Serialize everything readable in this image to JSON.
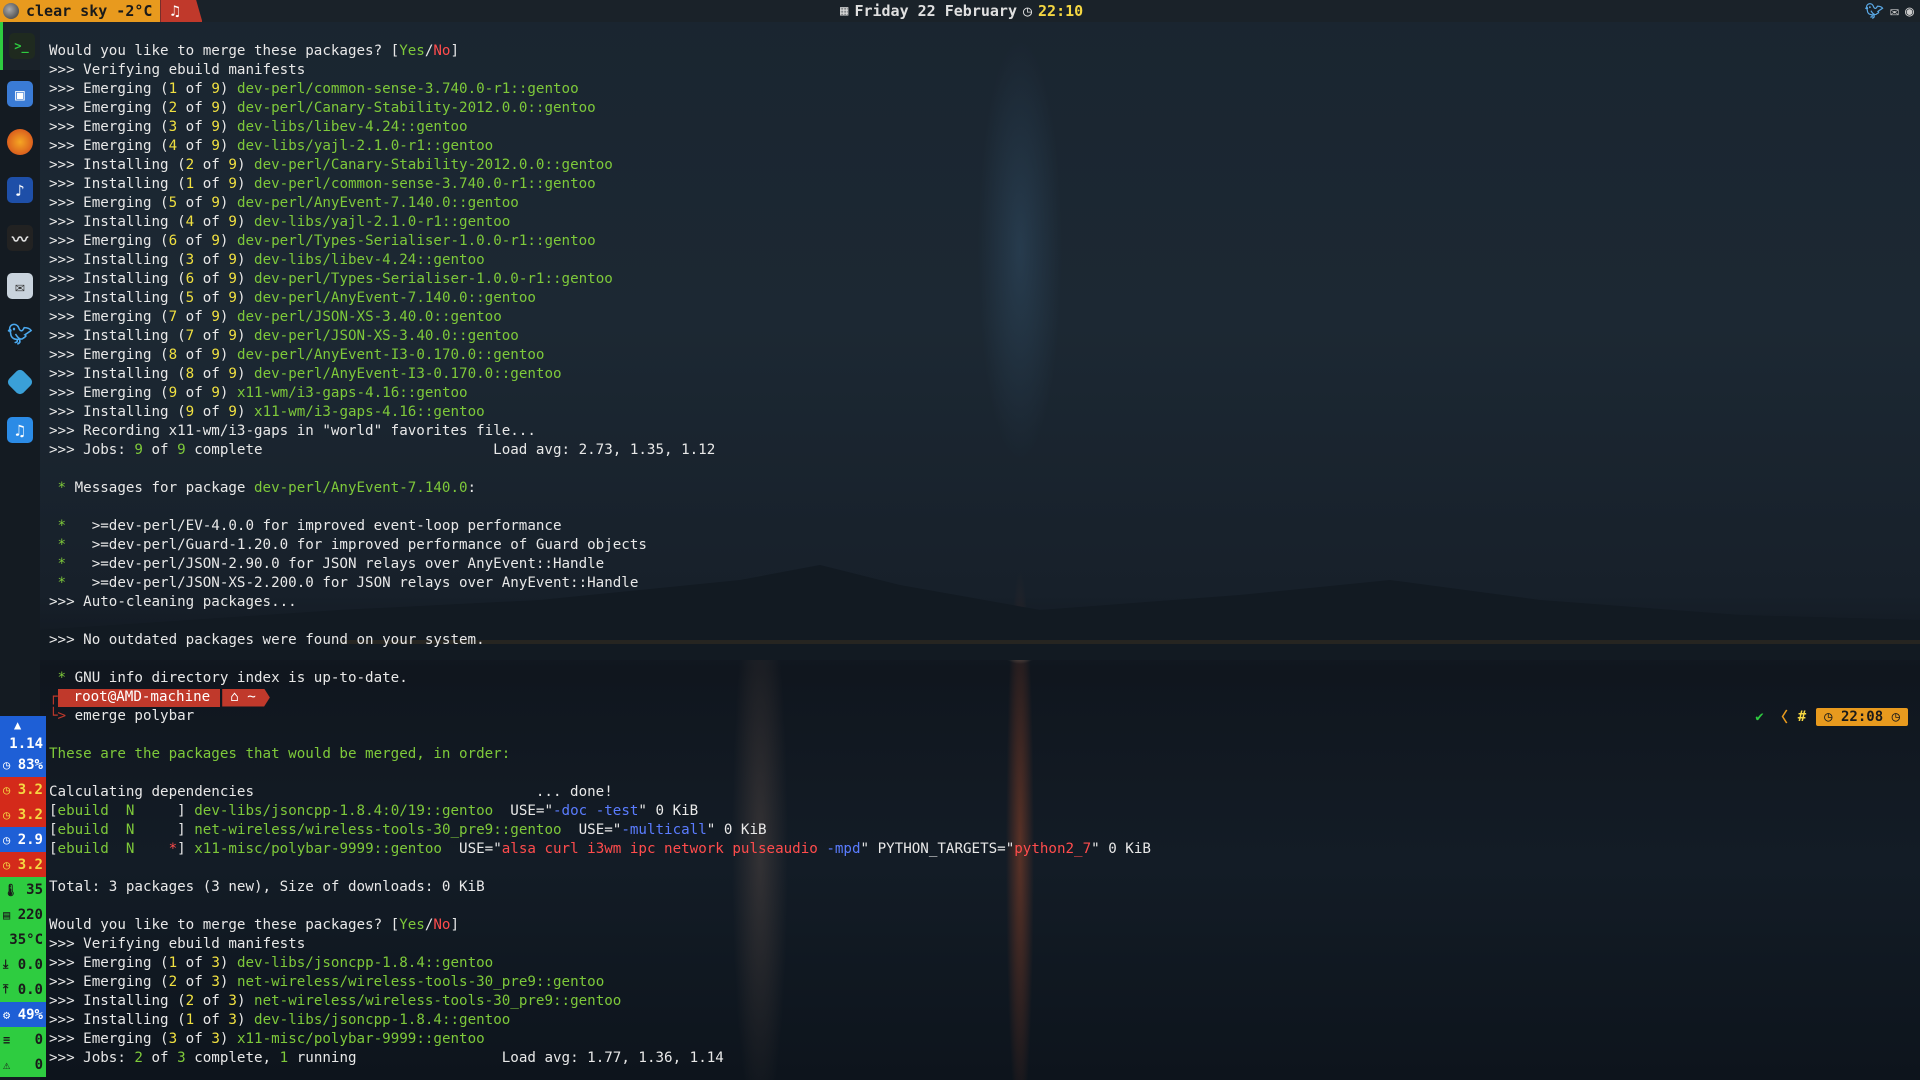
{
  "topbar": {
    "weather": "clear sky -2°C",
    "music_icon": "music-note-icon",
    "date": "Friday 22 February",
    "time": "22:10",
    "tray_icons": [
      "twitter-icon",
      "mail-icon",
      "steam-icon"
    ]
  },
  "dock": {
    "items": [
      "terminal",
      "files",
      "firefox",
      "music-player",
      "mixer",
      "mail",
      "twitter",
      "kodi",
      "itunes"
    ]
  },
  "stats": [
    {
      "icon": "cpu-icon",
      "value": "1.14",
      "bg": "#1e5fd6",
      "fg": "#ffffff"
    },
    {
      "icon": "clock-icon",
      "value": "83%",
      "bg": "#1e5fd6",
      "fg": "#ffffff"
    },
    {
      "icon": "clock-icon",
      "value": "3.2",
      "bg": "#d42a1a",
      "fg": "#f5d742"
    },
    {
      "icon": "clock-icon",
      "value": "3.2",
      "bg": "#d42a1a",
      "fg": "#f5d742"
    },
    {
      "icon": "clock-icon",
      "value": "2.9",
      "bg": "#1e5fd6",
      "fg": "#ffffff"
    },
    {
      "icon": "clock-icon",
      "value": "3.2",
      "bg": "#d42a1a",
      "fg": "#f5d742"
    },
    {
      "icon": "thermometer-icon",
      "value": "35",
      "bg": "#2ecc40",
      "fg": "#1a1a1a"
    },
    {
      "icon": "memory-icon",
      "value": "220",
      "bg": "#2ecc40",
      "fg": "#1a1a1a"
    },
    {
      "icon": "",
      "value": "35°C",
      "bg": "#2ecc40",
      "fg": "#1a1a1a"
    },
    {
      "icon": "download-icon",
      "value": "0.0",
      "bg": "#2ecc40",
      "fg": "#1a1a1a"
    },
    {
      "icon": "upload-icon",
      "value": "0.0",
      "bg": "#2ecc40",
      "fg": "#1a1a1a"
    },
    {
      "icon": "gear-icon",
      "value": "49%",
      "bg": "#1e5fd6",
      "fg": "#ffffff"
    },
    {
      "icon": "list-icon",
      "value": "0",
      "bg": "#2ecc40",
      "fg": "#1a1a1a"
    },
    {
      "icon": "warning-icon",
      "value": "0",
      "bg": "#2ecc40",
      "fg": "#1a1a1a"
    }
  ],
  "prompt": {
    "user": "root@AMD-machine",
    "dir": "~",
    "command": "emerge polybar",
    "right_time": "22:08",
    "right_symbol": "#"
  },
  "terminal": [
    [
      [
        "Would you like to merge these packages? [",
        "w"
      ],
      [
        "Yes",
        "g"
      ],
      [
        "/",
        "w"
      ],
      [
        "No",
        "r"
      ],
      [
        "]",
        "w"
      ]
    ],
    [
      [
        ">>> Verifying ebuild manifests",
        "w"
      ]
    ],
    [
      [
        ">>> Emerging (",
        "w"
      ],
      [
        "1",
        "y"
      ],
      [
        " of ",
        "w"
      ],
      [
        "9",
        "y"
      ],
      [
        ") ",
        "w"
      ],
      [
        "dev-perl/common-sense-3.740.0-r1::gentoo",
        "g"
      ]
    ],
    [
      [
        ">>> Emerging (",
        "w"
      ],
      [
        "2",
        "y"
      ],
      [
        " of ",
        "w"
      ],
      [
        "9",
        "y"
      ],
      [
        ") ",
        "w"
      ],
      [
        "dev-perl/Canary-Stability-2012.0.0::gentoo",
        "g"
      ]
    ],
    [
      [
        ">>> Emerging (",
        "w"
      ],
      [
        "3",
        "y"
      ],
      [
        " of ",
        "w"
      ],
      [
        "9",
        "y"
      ],
      [
        ") ",
        "w"
      ],
      [
        "dev-libs/libev-4.24::gentoo",
        "g"
      ]
    ],
    [
      [
        ">>> Emerging (",
        "w"
      ],
      [
        "4",
        "y"
      ],
      [
        " of ",
        "w"
      ],
      [
        "9",
        "y"
      ],
      [
        ") ",
        "w"
      ],
      [
        "dev-libs/yajl-2.1.0-r1::gentoo",
        "g"
      ]
    ],
    [
      [
        ">>> Installing (",
        "w"
      ],
      [
        "2",
        "y"
      ],
      [
        " of ",
        "w"
      ],
      [
        "9",
        "y"
      ],
      [
        ") ",
        "w"
      ],
      [
        "dev-perl/Canary-Stability-2012.0.0::gentoo",
        "g"
      ]
    ],
    [
      [
        ">>> Installing (",
        "w"
      ],
      [
        "1",
        "y"
      ],
      [
        " of ",
        "w"
      ],
      [
        "9",
        "y"
      ],
      [
        ") ",
        "w"
      ],
      [
        "dev-perl/common-sense-3.740.0-r1::gentoo",
        "g"
      ]
    ],
    [
      [
        ">>> Emerging (",
        "w"
      ],
      [
        "5",
        "y"
      ],
      [
        " of ",
        "w"
      ],
      [
        "9",
        "y"
      ],
      [
        ") ",
        "w"
      ],
      [
        "dev-perl/AnyEvent-7.140.0::gentoo",
        "g"
      ]
    ],
    [
      [
        ">>> Installing (",
        "w"
      ],
      [
        "4",
        "y"
      ],
      [
        " of ",
        "w"
      ],
      [
        "9",
        "y"
      ],
      [
        ") ",
        "w"
      ],
      [
        "dev-libs/yajl-2.1.0-r1::gentoo",
        "g"
      ]
    ],
    [
      [
        ">>> Emerging (",
        "w"
      ],
      [
        "6",
        "y"
      ],
      [
        " of ",
        "w"
      ],
      [
        "9",
        "y"
      ],
      [
        ") ",
        "w"
      ],
      [
        "dev-perl/Types-Serialiser-1.0.0-r1::gentoo",
        "g"
      ]
    ],
    [
      [
        ">>> Installing (",
        "w"
      ],
      [
        "3",
        "y"
      ],
      [
        " of ",
        "w"
      ],
      [
        "9",
        "y"
      ],
      [
        ") ",
        "w"
      ],
      [
        "dev-libs/libev-4.24::gentoo",
        "g"
      ]
    ],
    [
      [
        ">>> Installing (",
        "w"
      ],
      [
        "6",
        "y"
      ],
      [
        " of ",
        "w"
      ],
      [
        "9",
        "y"
      ],
      [
        ") ",
        "w"
      ],
      [
        "dev-perl/Types-Serialiser-1.0.0-r1::gentoo",
        "g"
      ]
    ],
    [
      [
        ">>> Installing (",
        "w"
      ],
      [
        "5",
        "y"
      ],
      [
        " of ",
        "w"
      ],
      [
        "9",
        "y"
      ],
      [
        ") ",
        "w"
      ],
      [
        "dev-perl/AnyEvent-7.140.0::gentoo",
        "g"
      ]
    ],
    [
      [
        ">>> Emerging (",
        "w"
      ],
      [
        "7",
        "y"
      ],
      [
        " of ",
        "w"
      ],
      [
        "9",
        "y"
      ],
      [
        ") ",
        "w"
      ],
      [
        "dev-perl/JSON-XS-3.40.0::gentoo",
        "g"
      ]
    ],
    [
      [
        ">>> Installing (",
        "w"
      ],
      [
        "7",
        "y"
      ],
      [
        " of ",
        "w"
      ],
      [
        "9",
        "y"
      ],
      [
        ") ",
        "w"
      ],
      [
        "dev-perl/JSON-XS-3.40.0::gentoo",
        "g"
      ]
    ],
    [
      [
        ">>> Emerging (",
        "w"
      ],
      [
        "8",
        "y"
      ],
      [
        " of ",
        "w"
      ],
      [
        "9",
        "y"
      ],
      [
        ") ",
        "w"
      ],
      [
        "dev-perl/AnyEvent-I3-0.170.0::gentoo",
        "g"
      ]
    ],
    [
      [
        ">>> Installing (",
        "w"
      ],
      [
        "8",
        "y"
      ],
      [
        " of ",
        "w"
      ],
      [
        "9",
        "y"
      ],
      [
        ") ",
        "w"
      ],
      [
        "dev-perl/AnyEvent-I3-0.170.0::gentoo",
        "g"
      ]
    ],
    [
      [
        ">>> Emerging (",
        "w"
      ],
      [
        "9",
        "y"
      ],
      [
        " of ",
        "w"
      ],
      [
        "9",
        "y"
      ],
      [
        ") ",
        "w"
      ],
      [
        "x11-wm/i3-gaps-4.16::gentoo",
        "g"
      ]
    ],
    [
      [
        ">>> Installing (",
        "w"
      ],
      [
        "9",
        "y"
      ],
      [
        " of ",
        "w"
      ],
      [
        "9",
        "y"
      ],
      [
        ") ",
        "w"
      ],
      [
        "x11-wm/i3-gaps-4.16::gentoo",
        "g"
      ]
    ],
    [
      [
        ">>> Recording x11-wm/i3-gaps in \"world\" favorites file...",
        "w"
      ]
    ],
    [
      [
        ">>> Jobs: ",
        "w"
      ],
      [
        "9",
        "g"
      ],
      [
        " of ",
        "w"
      ],
      [
        "9",
        "g"
      ],
      [
        " complete                           Load avg: 2.73, 1.35, 1.12",
        "w"
      ]
    ],
    [
      [
        "",
        "w"
      ]
    ],
    [
      [
        " * ",
        "g"
      ],
      [
        "Messages for package ",
        "w"
      ],
      [
        "dev-perl/AnyEvent-7.140.0",
        "g"
      ],
      [
        ":",
        "w"
      ]
    ],
    [
      [
        "",
        "w"
      ]
    ],
    [
      [
        " *",
        "g"
      ],
      [
        "   >=dev-perl/EV-4.0.0 for improved event-loop performance",
        "w"
      ]
    ],
    [
      [
        " *",
        "g"
      ],
      [
        "   >=dev-perl/Guard-1.20.0 for improved performance of Guard objects",
        "w"
      ]
    ],
    [
      [
        " *",
        "g"
      ],
      [
        "   >=dev-perl/JSON-2.90.0 for JSON relays over AnyEvent::Handle",
        "w"
      ]
    ],
    [
      [
        " *",
        "g"
      ],
      [
        "   >=dev-perl/JSON-XS-2.200.0 for JSON relays over AnyEvent::Handle",
        "w"
      ]
    ],
    [
      [
        ">>> Auto-cleaning packages...",
        "w"
      ]
    ],
    [
      [
        "",
        "w"
      ]
    ],
    [
      [
        ">>> No outdated packages were found on your system.",
        "w"
      ]
    ],
    [
      [
        "",
        "w"
      ]
    ],
    [
      [
        " * ",
        "g"
      ],
      [
        "GNU info directory index is up-to-date.",
        "w"
      ]
    ],
    [
      [
        "__PROMPT__",
        "w"
      ]
    ],
    [
      [
        "__CMD__",
        "w"
      ]
    ],
    [
      [
        "",
        "w"
      ]
    ],
    [
      [
        "These are the packages that would be merged, in order:",
        "g"
      ]
    ],
    [
      [
        "",
        "w"
      ]
    ],
    [
      [
        "Calculating dependencies                                 ... done!",
        "w"
      ]
    ],
    [
      [
        "[",
        "w"
      ],
      [
        "ebuild  N     ",
        "g"
      ],
      [
        "] ",
        "w"
      ],
      [
        "dev-libs/jsoncpp-1.8.4:0/19::gentoo",
        "g"
      ],
      [
        "  USE=\"",
        "w"
      ],
      [
        "-doc -test",
        "b"
      ],
      [
        "\" 0 KiB",
        "w"
      ]
    ],
    [
      [
        "[",
        "w"
      ],
      [
        "ebuild  N     ",
        "g"
      ],
      [
        "] ",
        "w"
      ],
      [
        "net-wireless/wireless-tools-30_pre9::gentoo",
        "g"
      ],
      [
        "  USE=\"",
        "w"
      ],
      [
        "-multicall",
        "b"
      ],
      [
        "\" 0 KiB",
        "w"
      ]
    ],
    [
      [
        "[",
        "w"
      ],
      [
        "ebuild  N    ",
        "g"
      ],
      [
        "*",
        "r"
      ],
      [
        "] ",
        "w"
      ],
      [
        "x11-misc/polybar-9999::gentoo",
        "g"
      ],
      [
        "  USE=\"",
        "w"
      ],
      [
        "alsa curl i3wm ipc network pulseaudio ",
        "r"
      ],
      [
        "-mpd",
        "b"
      ],
      [
        "\" PYTHON_TARGETS=\"",
        "w"
      ],
      [
        "python2_7",
        "r"
      ],
      [
        "\" 0 KiB",
        "w"
      ]
    ],
    [
      [
        "",
        "w"
      ]
    ],
    [
      [
        "Total: 3 packages (3 new), Size of downloads: 0 KiB",
        "w"
      ]
    ],
    [
      [
        "",
        "w"
      ]
    ],
    [
      [
        "Would you like to merge these packages? [",
        "w"
      ],
      [
        "Yes",
        "g"
      ],
      [
        "/",
        "w"
      ],
      [
        "No",
        "r"
      ],
      [
        "]",
        "w"
      ]
    ],
    [
      [
        ">>> Verifying ebuild manifests",
        "w"
      ]
    ],
    [
      [
        ">>> Emerging (",
        "w"
      ],
      [
        "1",
        "y"
      ],
      [
        " of ",
        "w"
      ],
      [
        "3",
        "y"
      ],
      [
        ") ",
        "w"
      ],
      [
        "dev-libs/jsoncpp-1.8.4::gentoo",
        "g"
      ]
    ],
    [
      [
        ">>> Emerging (",
        "w"
      ],
      [
        "2",
        "y"
      ],
      [
        " of ",
        "w"
      ],
      [
        "3",
        "y"
      ],
      [
        ") ",
        "w"
      ],
      [
        "net-wireless/wireless-tools-30_pre9::gentoo",
        "g"
      ]
    ],
    [
      [
        ">>> Installing (",
        "w"
      ],
      [
        "2",
        "y"
      ],
      [
        " of ",
        "w"
      ],
      [
        "3",
        "y"
      ],
      [
        ") ",
        "w"
      ],
      [
        "net-wireless/wireless-tools-30_pre9::gentoo",
        "g"
      ]
    ],
    [
      [
        ">>> Installing (",
        "w"
      ],
      [
        "1",
        "y"
      ],
      [
        " of ",
        "w"
      ],
      [
        "3",
        "y"
      ],
      [
        ") ",
        "w"
      ],
      [
        "dev-libs/jsoncpp-1.8.4::gentoo",
        "g"
      ]
    ],
    [
      [
        ">>> Emerging (",
        "w"
      ],
      [
        "3",
        "y"
      ],
      [
        " of ",
        "w"
      ],
      [
        "3",
        "y"
      ],
      [
        ") ",
        "w"
      ],
      [
        "x11-misc/polybar-9999::gentoo",
        "g"
      ]
    ],
    [
      [
        ">>> Jobs: ",
        "w"
      ],
      [
        "2",
        "g"
      ],
      [
        " of ",
        "w"
      ],
      [
        "3",
        "g"
      ],
      [
        " complete, ",
        "w"
      ],
      [
        "1",
        "g"
      ],
      [
        " running                 Load avg: 1.77, 1.36, 1.14",
        "w"
      ]
    ]
  ]
}
